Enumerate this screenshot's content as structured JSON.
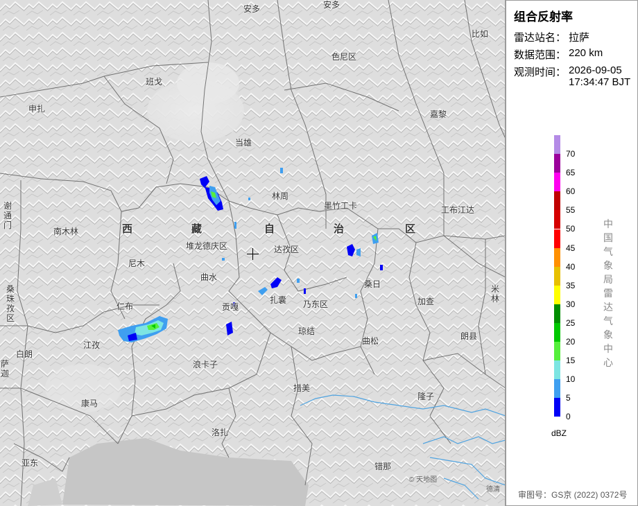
{
  "product": {
    "title": "组合反射率",
    "station_label": "雷达站名：",
    "station_value": "拉萨",
    "range_label": "数据范围：",
    "range_value": "220 km",
    "time_label": "观测时间：",
    "time_date": "2026-09-05",
    "time_clock": "17:34:47 BJT"
  },
  "legend": {
    "unit": "dBZ",
    "bins": [
      {
        "value": "70",
        "color": "#b48be6"
      },
      {
        "value": "65",
        "color": "#9c009c"
      },
      {
        "value": "60",
        "color": "#ff00f0"
      },
      {
        "value": "55",
        "color": "#c00000"
      },
      {
        "value": "50",
        "color": "#d60000"
      },
      {
        "value": "45",
        "color": "#ff0000"
      },
      {
        "value": "40",
        "color": "#ff9000"
      },
      {
        "value": "35",
        "color": "#e7c000"
      },
      {
        "value": "30",
        "color": "#ffff00"
      },
      {
        "value": "25",
        "color": "#008e00"
      },
      {
        "value": "20",
        "color": "#00c800"
      },
      {
        "value": "15",
        "color": "#55ef3c"
      },
      {
        "value": "10",
        "color": "#7de5e2"
      },
      {
        "value": "5",
        "color": "#3f9ff0"
      },
      {
        "value": "0",
        "color": "#0000f6"
      }
    ]
  },
  "agency_vertical": "中国气象局雷达气象中心",
  "approval": "审图号：GS京 (2022) 0372号",
  "watermark": "© 天地图",
  "watermark2": "德清",
  "map": {
    "places": [
      {
        "name": "安多"
      },
      {
        "name": "安多"
      },
      {
        "name": "比如"
      },
      {
        "name": "色尼区"
      },
      {
        "name": "班戈"
      },
      {
        "name": "申扎"
      },
      {
        "name": "嘉黎"
      },
      {
        "name": "当雄"
      },
      {
        "name": "林周"
      },
      {
        "name": "墨竹工卡"
      },
      {
        "name": "工布江达"
      },
      {
        "name": "南木林"
      },
      {
        "name": "堆龙德庆区"
      },
      {
        "name": "达孜区"
      },
      {
        "name": "尼木"
      },
      {
        "name": "曲水"
      },
      {
        "name": "桑日"
      },
      {
        "name": "加查"
      },
      {
        "name": "贡嘎"
      },
      {
        "name": "扎囊"
      },
      {
        "name": "乃东区"
      },
      {
        "name": "仁布"
      },
      {
        "name": "琼结"
      },
      {
        "name": "曲松"
      },
      {
        "name": "朗县"
      },
      {
        "name": "江孜"
      },
      {
        "name": "白朗"
      },
      {
        "name": "浪卡子"
      },
      {
        "name": "措美"
      },
      {
        "name": "隆子"
      },
      {
        "name": "康马"
      },
      {
        "name": "洛扎"
      },
      {
        "name": "亚东"
      },
      {
        "name": "错那"
      }
    ],
    "vertical_places": [
      {
        "name": "谢通门"
      },
      {
        "name": "桑珠孜区"
      },
      {
        "name": "米林"
      },
      {
        "name": "萨迦"
      }
    ],
    "region_chars": [
      "西",
      "藏",
      "自",
      "治",
      "区"
    ]
  }
}
